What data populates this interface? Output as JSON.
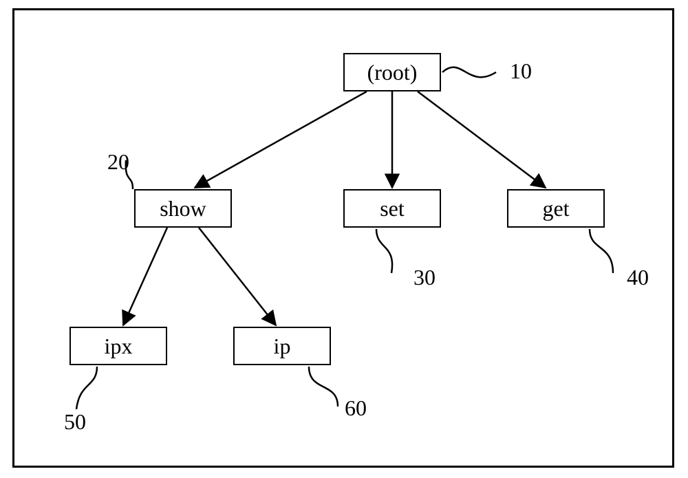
{
  "diagram": {
    "nodes": {
      "root": {
        "label": "(root)",
        "ref": "10"
      },
      "show": {
        "label": "show",
        "ref": "20"
      },
      "set": {
        "label": "set",
        "ref": "30"
      },
      "get": {
        "label": "get",
        "ref": "40"
      },
      "ipx": {
        "label": "ipx",
        "ref": "50"
      },
      "ip": {
        "label": "ip",
        "ref": "60"
      }
    },
    "edges": [
      [
        "root",
        "show"
      ],
      [
        "root",
        "set"
      ],
      [
        "root",
        "get"
      ],
      [
        "show",
        "ipx"
      ],
      [
        "show",
        "ip"
      ]
    ]
  }
}
